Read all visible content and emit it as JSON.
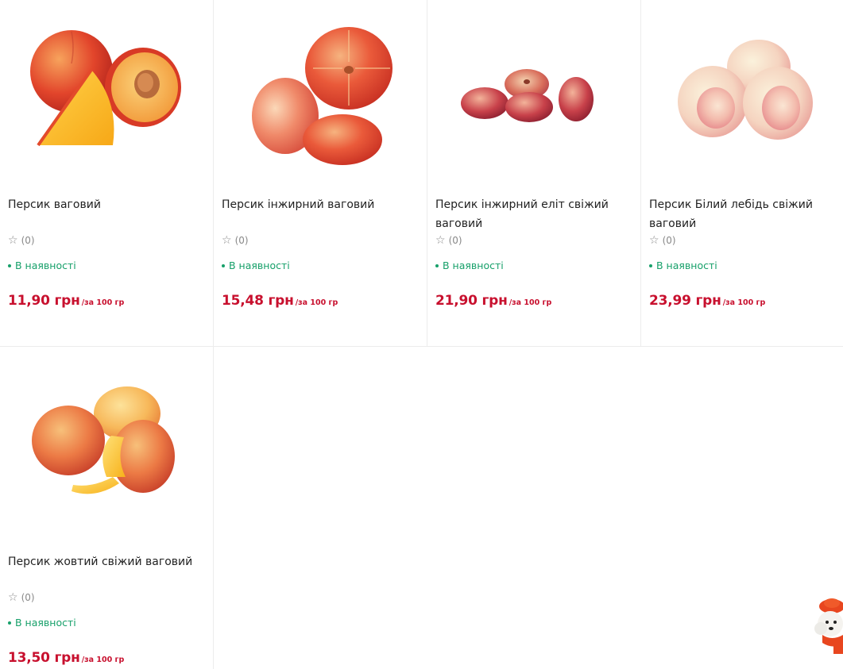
{
  "products": [
    {
      "name": "Персик ваговий",
      "rating_count": "(0)",
      "stock": "В наявності",
      "price": "11,90 грн",
      "unit": "/за 100 гр",
      "image": "peach-halved-image"
    },
    {
      "name": "Персик інжирний ваговий",
      "rating_count": "(0)",
      "stock": "В наявності",
      "price": "15,48 грн",
      "unit": "/за 100 гр",
      "image": "flat-peach-image"
    },
    {
      "name": "Персик інжирний еліт свіжий ваговий",
      "rating_count": "(0)",
      "stock": "В наявності",
      "price": "21,90 грн",
      "unit": "/за 100 гр",
      "image": "flat-peach-small-image"
    },
    {
      "name": "Персик Білий лебідь свіжий ваговий",
      "rating_count": "(0)",
      "stock": "В наявності",
      "price": "23,99 грн",
      "unit": "/за 100 гр",
      "image": "white-peach-image"
    },
    {
      "name": "Персик жовтий свіжий ваговий",
      "rating_count": "(0)",
      "stock": "В наявності",
      "price": "13,50 грн",
      "unit": "/за 100 гр",
      "image": "yellow-peach-image"
    }
  ],
  "colors": {
    "price": "#c8102e",
    "stock": "#17a06a",
    "border": "#ececec"
  },
  "icons": {
    "rating": "star-outline-icon",
    "stock": "dot-icon",
    "assistant": "dog-mascot-icon"
  }
}
